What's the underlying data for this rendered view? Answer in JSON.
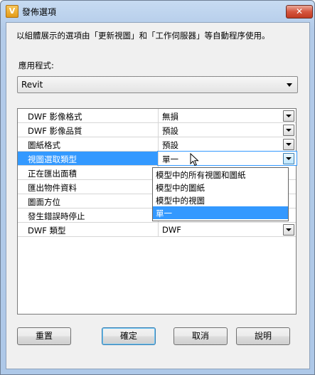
{
  "window": {
    "title": "發佈選項",
    "app_icon_letter": "V"
  },
  "description": "以組體展示的選項由「更新視圖」和「工作伺服器」等自動程序使用。",
  "app_select": {
    "label": "應用程式:",
    "value": "Revit"
  },
  "properties": [
    {
      "name": "DWF 影像格式",
      "value": "無損",
      "has_dropdown": true
    },
    {
      "name": "DWF 影像品質",
      "value": "預設",
      "has_dropdown": true
    },
    {
      "name": "圖紙格式",
      "value": "預設",
      "has_dropdown": true
    },
    {
      "name": "視圖選取類型",
      "value": "單一",
      "has_dropdown": true,
      "selected": true
    },
    {
      "name": "正在匯出面積",
      "value": "",
      "has_dropdown": false
    },
    {
      "name": "匯出物件資料",
      "value": "",
      "has_dropdown": false
    },
    {
      "name": "圖面方位",
      "value": "",
      "has_dropdown": false
    },
    {
      "name": "發生錯誤時停止",
      "value": "",
      "has_dropdown": false
    },
    {
      "name": "DWF 類型",
      "value": "DWF",
      "has_dropdown": true
    }
  ],
  "dropdown_options": [
    {
      "label": "模型中的所有視圖和圖紙",
      "highlighted": false
    },
    {
      "label": "模型中的圖紙",
      "highlighted": false
    },
    {
      "label": "模型中的視圖",
      "highlighted": false
    },
    {
      "label": "單一",
      "highlighted": true
    }
  ],
  "buttons": {
    "reset": "重置",
    "ok": "確定",
    "cancel": "取消",
    "help": "說明"
  }
}
